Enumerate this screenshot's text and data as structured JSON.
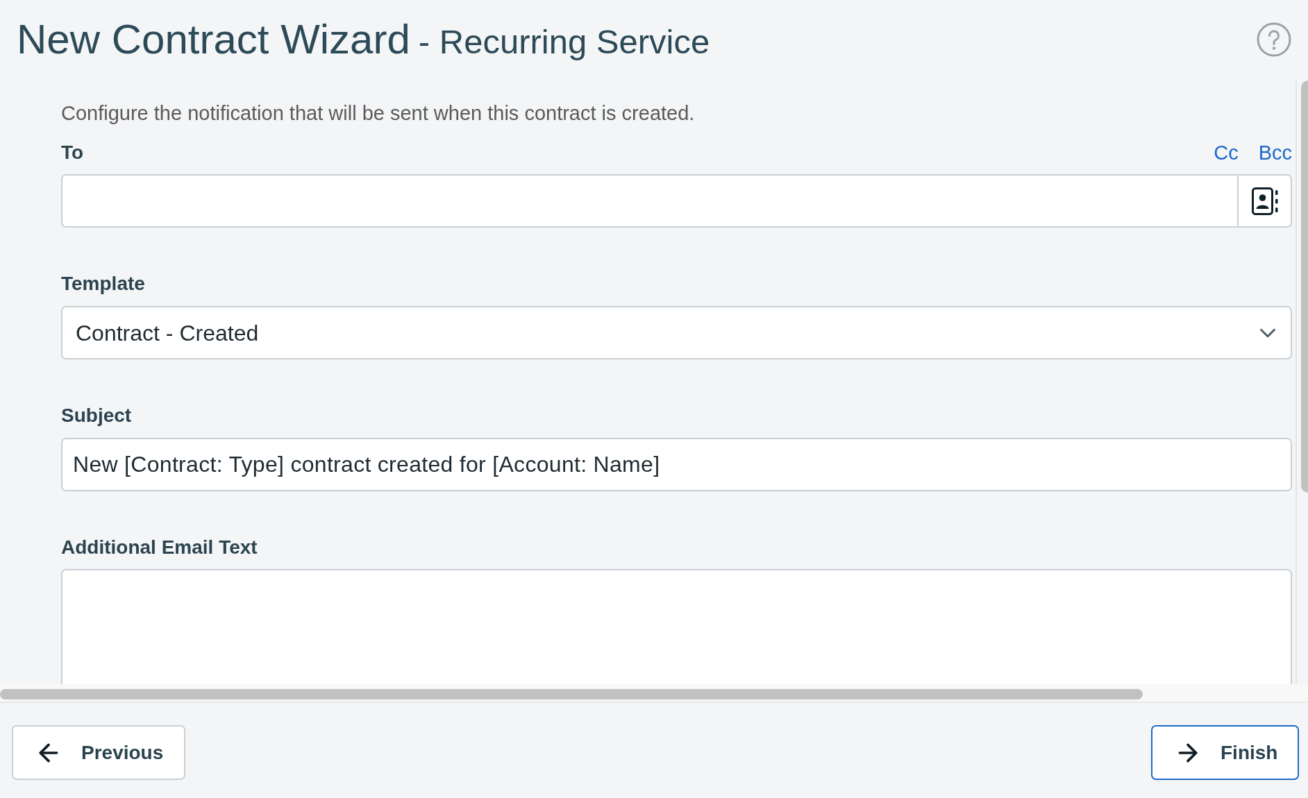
{
  "header": {
    "title": "New Contract Wizard",
    "subtitle": "- Recurring Service"
  },
  "form": {
    "description": "Configure the notification that will be sent when this contract is created.",
    "to": {
      "label": "To",
      "links": [
        "Cc",
        "Bcc"
      ]
    },
    "template": {
      "label": "Template",
      "value": "Contract - Created"
    },
    "subject": {
      "label": "Subject",
      "value": "New [Contract: Type] contract created for [Account: Name]"
    },
    "additional_email_text": {
      "label": "Additional Email Text"
    }
  },
  "footer": {
    "buttons": [
      {
        "label": "Previous",
        "kind": "back"
      },
      {
        "label": "Finish",
        "kind": "forward"
      }
    ]
  }
}
